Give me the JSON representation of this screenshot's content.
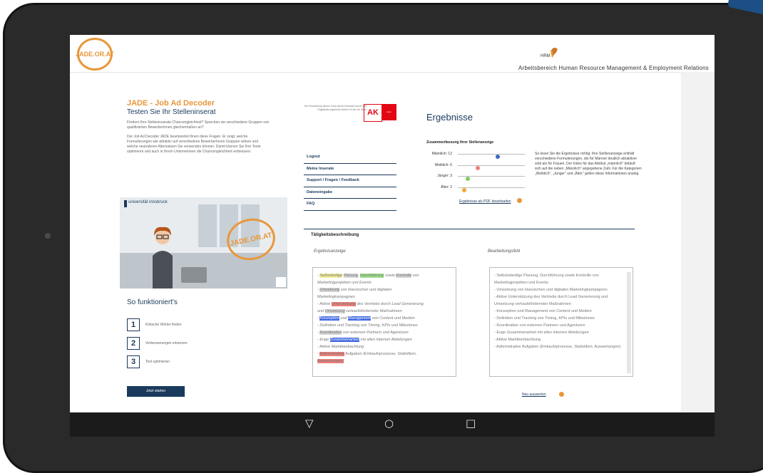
{
  "header": {
    "logo_text": "JADE.OR.AT",
    "hrm_logo_text": "HRM",
    "department": "Arbeitsbereich Human Resource Management & Employment Relations"
  },
  "intro": {
    "title": "JADE - Job Ad Decoder",
    "subtitle": "Testen Sie Ihr Stelleninserat",
    "para1": "Fördern Ihre Stelleninserate Chancengleichheit? Sprechen sie verschiedene Gruppen von qualifizierten BewerberInnen gleichermaßen an?",
    "para2": "Der Job Ad Decoder JADE beantwortet Ihnen diese Fragen. Er zeigt, welche Formulierungen wie attraktiv auf verschiedene BewerberInnen Gruppen wirken und welche neutraleren Alternativen Sie verwenden können. Damit können Sie Ihre Texte optimieren und auch in Ihrem Unternehmen die Chancengleichheit verbessern."
  },
  "video": {
    "university": "universität innsbruck",
    "stamp_text": "JADE.OR.AT"
  },
  "howto": {
    "title": "So funktioniert's",
    "steps": [
      {
        "num": "1",
        "label": "Kritische Wörter finden"
      },
      {
        "num": "2",
        "label": "Verbesserungen erkennen"
      },
      {
        "num": "3",
        "label": "Text optimieren"
      }
    ],
    "start_button": "Jetzt starten"
  },
  "funding": {
    "text": "Die Entwicklung dieses Tools wurde finanziert durch den Digitalisierungsfonds Arbeit 4.0 der AK Wien",
    "ak_logo": "AK",
    "ak_sub": "wien"
  },
  "menu": {
    "items": [
      "Logout",
      "Meine Inserate",
      "Support / Fragen / Feedback",
      "Dateneingabe",
      "FAQ"
    ]
  },
  "results": {
    "title": "Ergebnisse",
    "summary_title": "Zusammenfassung Ihrer Stellenanzeige",
    "sliders": [
      {
        "label": "Männlich: 12",
        "value": 12,
        "max": 20,
        "color": "#3d66c8"
      },
      {
        "label": "Weiblich: 6",
        "value": 6,
        "max": 20,
        "color": "#ef7f7a"
      },
      {
        "label": "Jünger: 3",
        "value": 3,
        "max": 20,
        "color": "#7ccf5e"
      },
      {
        "label": "Älter: 2",
        "value": 2,
        "max": 20,
        "color": "#f0a830"
      }
    ],
    "explanation": "So lesen Sie die Ergebnisse richtig: Ihre Stellenanzeige enthält verschiedene Formulierungen, die für Männer deutlich attraktiver sind als für Frauen. Der Index für das Attribut „männlich\" beläuft sich auf die neben „Männlich\" angegebene Zahl. Für die Kategorien „Weiblich\", „Jünger\" und „Älter\" gelten diese Informationen analog.",
    "pdf_link": "Ergebnisse als PDF downloaden"
  },
  "activity": {
    "title": "Tätigkeitsbeschreibung",
    "left_header": "Ergebnisanzeige",
    "right_header": "Bearbeitungsfeld",
    "right_text": "- Selbstständige Planung, Durchführung sowie Kontrolle von Marketingprojekten und Events\n- Umsetzung von klassischen und digitalen Marketingkampagnen\n- Aktive Unterstützung des Vertriebs durch Lead Generierung und Umsetzung verkaufsfördernder Maßnahmen\n- Konzeption und Management von Content und Medien\n- Definition und Tracking von Timing, KPIs und Milestones\n- Koordination von externen Partnern und Agenturen\n- Enge Zusammenarbeit mit allen internen Abteilungen\n- Aktive Marktbeobachtung\n- Administrative Aufgaben (Einkaufsprozesse, Statistiken, Auswertungen)",
    "reevaluate": "Neu auswerten"
  },
  "highlighted": {
    "l1a": "- ",
    "l1b": "Selbständige",
    "l1c": " ",
    "l1d": "Planung",
    "l1e": ", ",
    "l1f": "Durchführung",
    "l1g": " sowie ",
    "l1h": "Kontrolle",
    "l1i": " von",
    "l2": "Marketingprojekten und Events",
    "l3a": "- ",
    "l3b": "Umsetzung",
    "l3c": " von klassischen und digitalen",
    "l4": "Marketingkampagnen",
    "l5a": "- Aktive ",
    "l5b": "Unterstützung",
    "l5c": " des Vertriebs durch Lead Generierung",
    "l6a": "und ",
    "l6b": "Umsetzung",
    "l6c": " verkaufsfördernder Maßnahmen",
    "l7a": "- ",
    "l7b": "Konzeption",
    "l7c": " und ",
    "l7d": "Management",
    "l7e": " von Content und Medien",
    "l8": "- Definition und Tracking von Timing, KPIs und Milestones",
    "l9a": "- ",
    "l9b": "Koordination",
    "l9c": " von externen Partnern und Agenturen",
    "l10a": "- Enge ",
    "l10b": "Zusammenarbeit",
    "l10c": " mit allen internen Abteilungen",
    "l11": "- Aktive Marktbeobachtung",
    "l12a": "- ",
    "l12b": "Administrative",
    "l12c": " Aufgaben (Einkaufsprozesse, Statistiken,",
    "l13": "Auswertungen)"
  },
  "android_nav": {
    "back": "▽",
    "home": "○",
    "recents": "□"
  }
}
